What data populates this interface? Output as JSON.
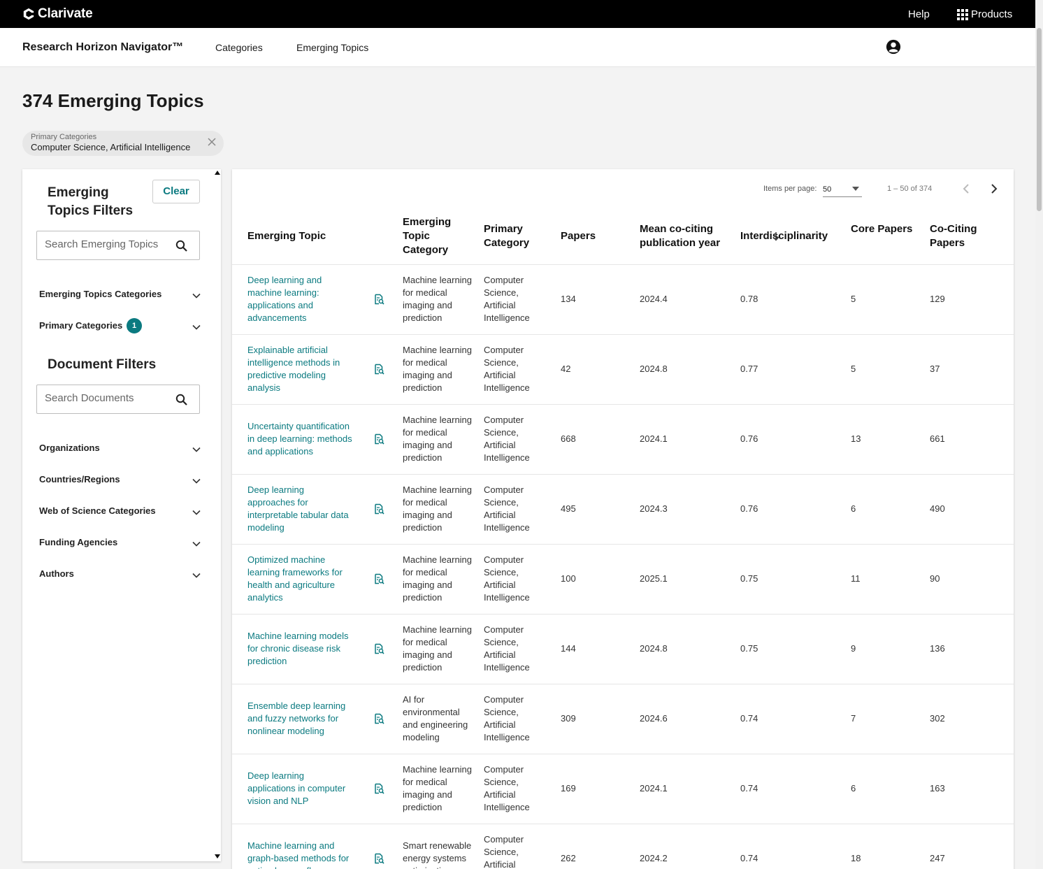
{
  "topbar": {
    "brand": "Clarivate",
    "help": "Help",
    "products": "Products"
  },
  "appbar": {
    "title": "Research Horizon Navigator™",
    "nav": [
      "Categories",
      "Emerging Topics"
    ]
  },
  "page": {
    "title": "374 Emerging Topics"
  },
  "active_filter": {
    "label": "Primary Categories",
    "value": "Computer Science, Artificial Intelligence"
  },
  "sidebar": {
    "topic_filters_title": "Emerging Topics Filters",
    "clear": "Clear",
    "topic_search_placeholder": "Search Emerging Topics",
    "topic_facets": [
      {
        "label": "Emerging Topics Categories"
      },
      {
        "label": "Primary Categories",
        "badge": "1"
      }
    ],
    "document_filters_title": "Document Filters",
    "document_search_placeholder": "Search Documents",
    "document_facets": [
      {
        "label": "Organizations"
      },
      {
        "label": "Countries/Regions"
      },
      {
        "label": "Web of Science Categories"
      },
      {
        "label": "Funding Agencies"
      },
      {
        "label": "Authors"
      }
    ]
  },
  "pagination": {
    "items_per_page_label": "Items per page:",
    "items_per_page": "50",
    "range": "1 – 50 of 374"
  },
  "table": {
    "columns": [
      "Emerging Topic",
      "Emerging Topic Category",
      "Primary Category",
      "Papers",
      "Mean co-citing publication year",
      "Interdisciplinarity",
      "Core Papers",
      "Co-Citing Papers"
    ],
    "sorted_column": "Interdisciplinarity",
    "sort_direction": "descending",
    "rows": [
      {
        "topic": "Deep learning and machine learning: applications and advancements",
        "category": "Machine learning for medical imaging and prediction",
        "primary": "Computer Science, Artificial Intelligence",
        "papers": "134",
        "year": "2024.4",
        "interdisciplinarity": "0.78",
        "core": "5",
        "cociting": "129"
      },
      {
        "topic": "Explainable artificial intelligence methods in predictive modeling analysis",
        "category": "Machine learning for medical imaging and prediction",
        "primary": "Computer Science, Artificial Intelligence",
        "papers": "42",
        "year": "2024.8",
        "interdisciplinarity": "0.77",
        "core": "5",
        "cociting": "37"
      },
      {
        "topic": "Uncertainty quantification in deep learning: methods and applications",
        "category": "Machine learning for medical imaging and prediction",
        "primary": "Computer Science, Artificial Intelligence",
        "papers": "668",
        "year": "2024.1",
        "interdisciplinarity": "0.76",
        "core": "13",
        "cociting": "661"
      },
      {
        "topic": "Deep learning approaches for interpretable tabular data modeling",
        "category": "Machine learning for medical imaging and prediction",
        "primary": "Computer Science, Artificial Intelligence",
        "papers": "495",
        "year": "2024.3",
        "interdisciplinarity": "0.76",
        "core": "6",
        "cociting": "490"
      },
      {
        "topic": "Optimized machine learning frameworks for health and agriculture analytics",
        "category": "Machine learning for medical imaging and prediction",
        "primary": "Computer Science, Artificial Intelligence",
        "papers": "100",
        "year": "2025.1",
        "interdisciplinarity": "0.75",
        "core": "11",
        "cociting": "90"
      },
      {
        "topic": "Machine learning models for chronic disease risk prediction",
        "category": "Machine learning for medical imaging and prediction",
        "primary": "Computer Science, Artificial Intelligence",
        "papers": "144",
        "year": "2024.8",
        "interdisciplinarity": "0.75",
        "core": "9",
        "cociting": "136"
      },
      {
        "topic": "Ensemble deep learning and fuzzy networks for nonlinear modeling",
        "category": "AI for environmental and engineering modeling",
        "primary": "Computer Science, Artificial Intelligence",
        "papers": "309",
        "year": "2024.6",
        "interdisciplinarity": "0.74",
        "core": "7",
        "cociting": "302"
      },
      {
        "topic": "Deep learning applications in computer vision and NLP",
        "category": "Machine learning for medical imaging and prediction",
        "primary": "Computer Science, Artificial Intelligence",
        "papers": "169",
        "year": "2024.1",
        "interdisciplinarity": "0.74",
        "core": "6",
        "cociting": "163"
      },
      {
        "topic": "Machine learning and graph-based methods for optimal power flow",
        "category": "Smart renewable energy systems optimization",
        "primary": "Computer Science, Artificial Intelligence",
        "papers": "262",
        "year": "2024.2",
        "interdisciplinarity": "0.74",
        "core": "18",
        "cociting": "247"
      }
    ]
  }
}
